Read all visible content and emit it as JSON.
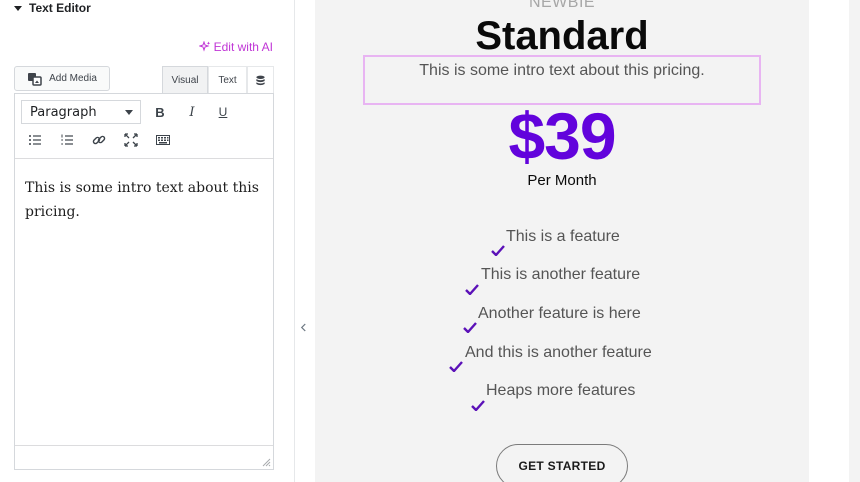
{
  "panel": {
    "section_title": "Text Editor",
    "ai_link": "Edit with AI",
    "add_media": "Add Media",
    "tabs": {
      "visual": "Visual",
      "text": "Text"
    },
    "format_select": "Paragraph",
    "toolbar": {
      "bold": "B",
      "italic": "I",
      "underline": "U"
    },
    "content": "This is some intro text about this pricing."
  },
  "card": {
    "pretitle": "NEWBIE",
    "title": "Standard",
    "intro": "This is some intro text about this pricing.",
    "price": "$39",
    "period": "Per Month",
    "features": [
      "This is a feature",
      "This is another feature",
      "Another feature is here",
      "And this is another feature",
      "Heaps more features"
    ],
    "cta": "GET STARTED"
  },
  "colors": {
    "accent": "#6203dc",
    "ai_link": "#c036d6",
    "selection_border": "#e8b4f2",
    "card_background": "#f3f3f3"
  },
  "icons": [
    "caret-down-icon",
    "sparkle-icon",
    "add-media-icon",
    "database-icon",
    "bulleted-list-icon",
    "numbered-list-icon",
    "link-icon",
    "fullscreen-icon",
    "toolbar-toggle-icon",
    "resize-grip-icon",
    "chevron-left-icon",
    "checkmark-icon"
  ]
}
